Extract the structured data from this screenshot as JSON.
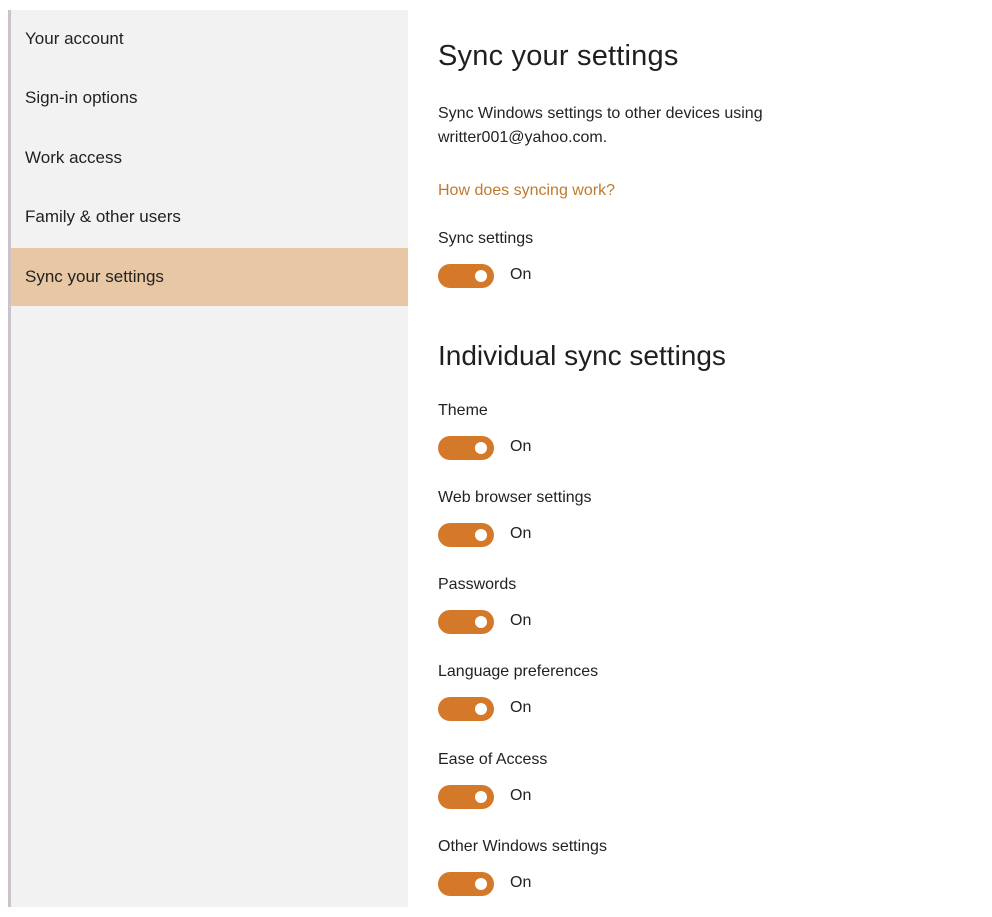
{
  "sidebar": {
    "items": [
      {
        "label": "Your account"
      },
      {
        "label": "Sign-in options"
      },
      {
        "label": "Work access"
      },
      {
        "label": "Family & other users"
      },
      {
        "label": "Sync your settings",
        "active": true
      }
    ]
  },
  "main": {
    "title": "Sync your settings",
    "description": "Sync Windows settings to other devices using writter001@yahoo.com.",
    "help_link": "How does syncing work?",
    "sync_settings": {
      "label": "Sync settings",
      "state": "On",
      "on": true
    },
    "individual_title": "Individual sync settings",
    "individual": [
      {
        "label": "Theme",
        "state": "On",
        "on": true
      },
      {
        "label": "Web browser settings",
        "state": "On",
        "on": true
      },
      {
        "label": "Passwords",
        "state": "On",
        "on": true
      },
      {
        "label": "Language preferences",
        "state": "On",
        "on": true
      },
      {
        "label": "Ease of Access",
        "state": "On",
        "on": true
      },
      {
        "label": "Other Windows settings",
        "state": "On",
        "on": true
      }
    ]
  },
  "colors": {
    "accent": "#d4792a",
    "selected_nav": "#e8c7a4",
    "link": "#c07a2e",
    "sidebar_bg": "#f2f2f2"
  }
}
